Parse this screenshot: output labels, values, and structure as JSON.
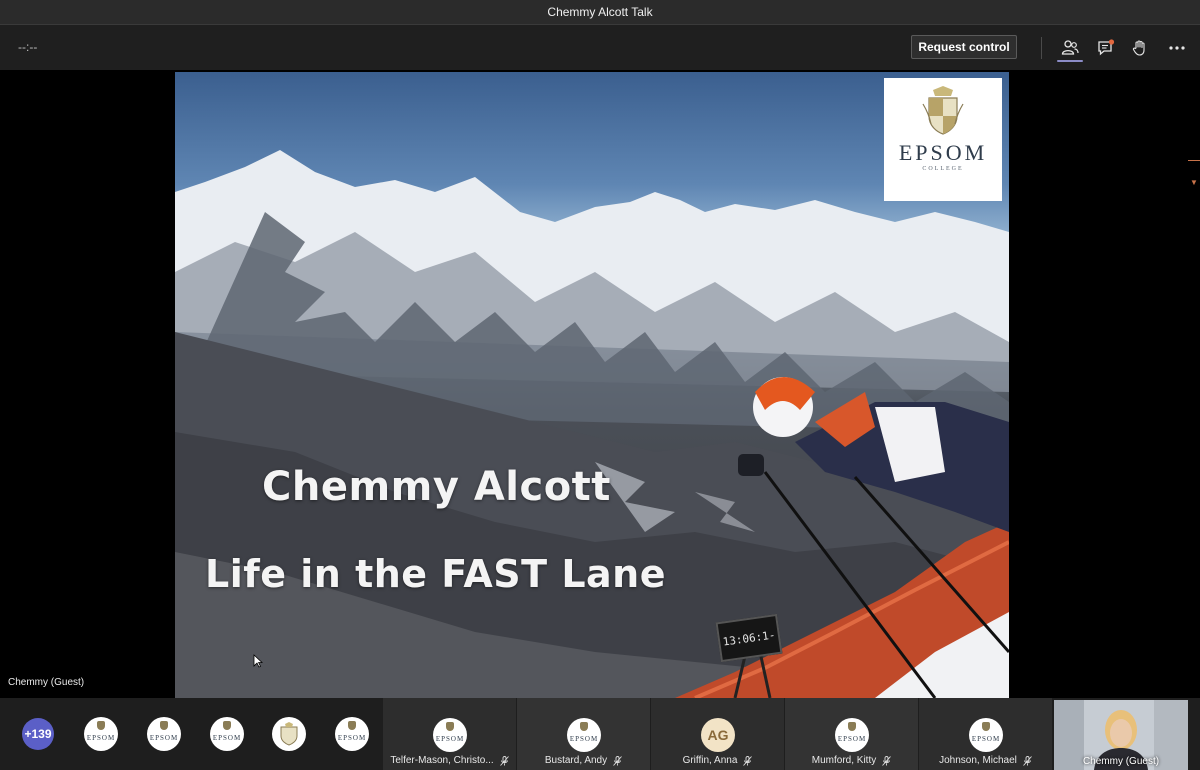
{
  "window": {
    "title": "Chemmy Alcott Talk"
  },
  "toolbar": {
    "timer": "--:--",
    "request_control_label": "Request control"
  },
  "slide": {
    "title": "Chemmy Alcott",
    "subtitle": "Life in the FAST Lane",
    "logo_name": "EPSOM",
    "logo_sub": "COLLEGE",
    "timing_board": "13:06:1-"
  },
  "presenter": {
    "name": "Chemmy (Guest)"
  },
  "participants": {
    "overflow_count": "+139",
    "avatar_text": "EPSOM",
    "tiles": [
      {
        "name": "Telfer-Mason, Christo..."
      },
      {
        "name": "Bustard, Andy"
      },
      {
        "name": "Griffin, Anna",
        "initials": "AG"
      },
      {
        "name": "Mumford, Kitty"
      },
      {
        "name": "Johnson, Michael"
      }
    ],
    "self_view": {
      "name": "Chemmy (Guest)"
    }
  },
  "colors": {
    "accent": "#5b5fc7",
    "titlebar": "#2b2b2b",
    "toolbar": "#1f1f1f",
    "notification_dot": "#e3683f"
  },
  "icons": [
    "people-icon",
    "chat-icon",
    "raise-hand-icon",
    "more-options-icon",
    "mic-off-icon"
  ]
}
